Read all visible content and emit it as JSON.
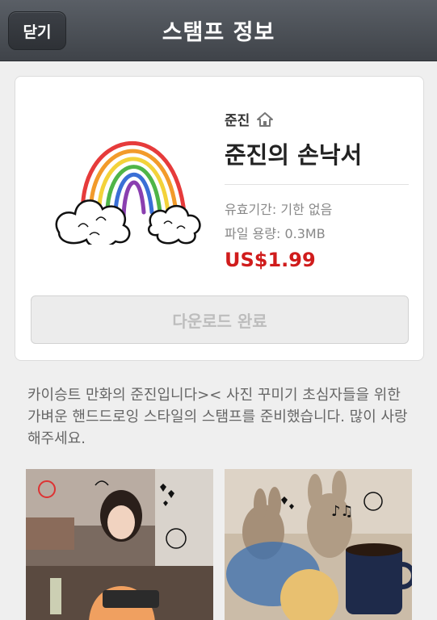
{
  "header": {
    "close_label": "닫기",
    "title": "스탬프 정보"
  },
  "stamp": {
    "author": "준진",
    "author_icon": "home-icon",
    "title": "준진의 손낙서",
    "validity": "유효기간: 기한 없음",
    "file_size": "파일 용량: 0.3MB",
    "price": "US$1.99",
    "price_color": "#d01c1c",
    "download_label": "다운로드 완료"
  },
  "description": "카이승트 만화의 준진입니다>< 사진 꾸미기 초심자들을 위한 가벼운 핸드드로잉 스타일의 스탬프를 준비했습니다. 많이 사랑해주세요.",
  "previews": [
    {
      "name": "preview-photo-woman-cafe"
    },
    {
      "name": "preview-photo-plush-coffee"
    }
  ]
}
